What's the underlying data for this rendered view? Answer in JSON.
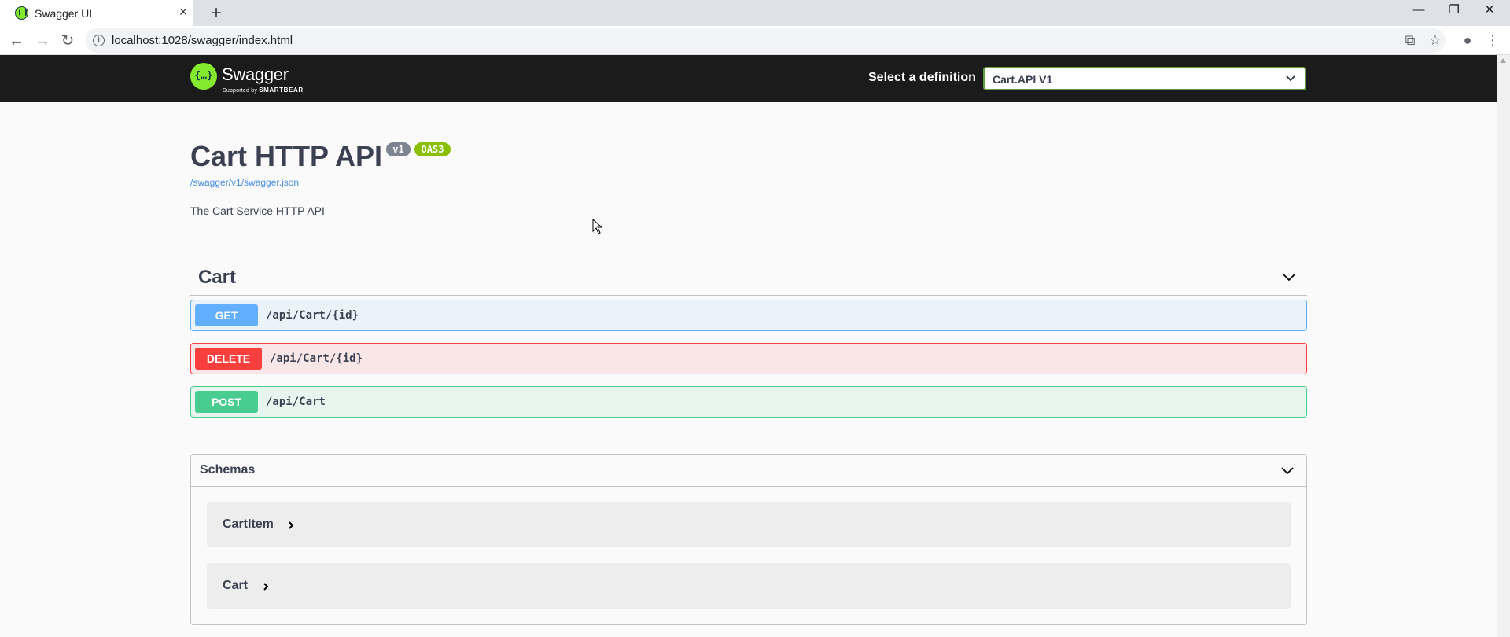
{
  "browser": {
    "tab_title": "Swagger UI",
    "url": "localhost:1028/swagger/index.html"
  },
  "topbar": {
    "logo_text": "Swagger",
    "logo_sub_prefix": "Supported by",
    "logo_sub_brand": "SMARTBEAR",
    "definition_label": "Select a definition",
    "definition_selected": "Cart.API V1"
  },
  "info": {
    "title": "Cart HTTP API",
    "version_badge": "v1",
    "oas_badge": "OAS3",
    "spec_link": "/swagger/v1/swagger.json",
    "description": "The Cart Service HTTP API"
  },
  "tag": {
    "name": "Cart",
    "operations": [
      {
        "method": "GET",
        "path": "/api/Cart/{id}"
      },
      {
        "method": "DELETE",
        "path": "/api/Cart/{id}"
      },
      {
        "method": "POST",
        "path": "/api/Cart"
      }
    ]
  },
  "schemas": {
    "title": "Schemas",
    "items": [
      {
        "name": "CartItem"
      },
      {
        "name": "Cart"
      }
    ]
  },
  "colors": {
    "get": "#61affe",
    "delete": "#f93e3e",
    "post": "#49cc90",
    "swagger_green": "#85ea2d",
    "topbar_bg": "#1b1b1b"
  }
}
